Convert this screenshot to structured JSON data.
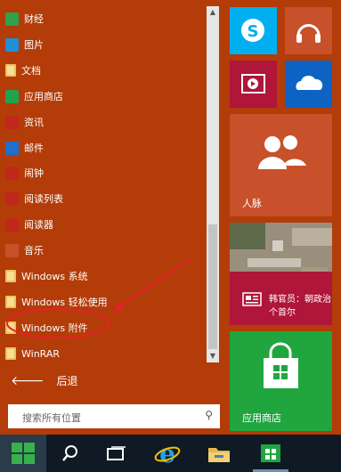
{
  "apps": [
    {
      "label": "财经",
      "icon": "finance-icon",
      "color": "#2fa24b",
      "kind": "app"
    },
    {
      "label": "图片",
      "icon": "photos-icon",
      "color": "#1f8fd6",
      "kind": "app"
    },
    {
      "label": "文档",
      "icon": "documents-folder-icon",
      "color": "#ebc25f",
      "kind": "folder"
    },
    {
      "label": "应用商店",
      "icon": "store-icon",
      "color": "#23a24d",
      "kind": "app"
    },
    {
      "label": "资讯",
      "icon": "news-icon",
      "color": "#c0281c",
      "kind": "app"
    },
    {
      "label": "邮件",
      "icon": "mail-icon",
      "color": "#1f6fcc",
      "kind": "app"
    },
    {
      "label": "闹钟",
      "icon": "alarm-icon",
      "color": "#c0281c",
      "kind": "app"
    },
    {
      "label": "阅读列表",
      "icon": "reading-list-icon",
      "color": "#c0281c",
      "kind": "app"
    },
    {
      "label": "阅读器",
      "icon": "reader-icon",
      "color": "#c0281c",
      "kind": "app"
    },
    {
      "label": "音乐",
      "icon": "music-icon",
      "color": "#c8502a",
      "kind": "app"
    },
    {
      "label": "Windows 系统",
      "icon": "folder-icon",
      "color": "#ebc25f",
      "kind": "folder"
    },
    {
      "label": "Windows 轻松使用",
      "icon": "folder-icon",
      "color": "#ebc25f",
      "kind": "folder"
    },
    {
      "label": "Windows 附件",
      "icon": "folder-icon",
      "color": "#ebc25f",
      "kind": "folder"
    },
    {
      "label": "WinRAR",
      "icon": "folder-icon",
      "color": "#ebc25f",
      "kind": "folder"
    }
  ],
  "back_label": "后退",
  "search_placeholder": "搜索所有位置",
  "tiles": {
    "people": {
      "label": "人脉"
    },
    "news": {
      "headline_line1": "韩官员：朝政治",
      "headline_line2": "个首尔"
    },
    "store": {
      "label": "应用商店"
    }
  },
  "colors": {
    "accent": "#b33c08",
    "skype": "#00aff0",
    "music": "#c8502a",
    "video": "#b0153a",
    "onedrive": "#0c63c4",
    "store": "#20a53f",
    "people": "#c8502a",
    "annotation": "#e8202a"
  }
}
